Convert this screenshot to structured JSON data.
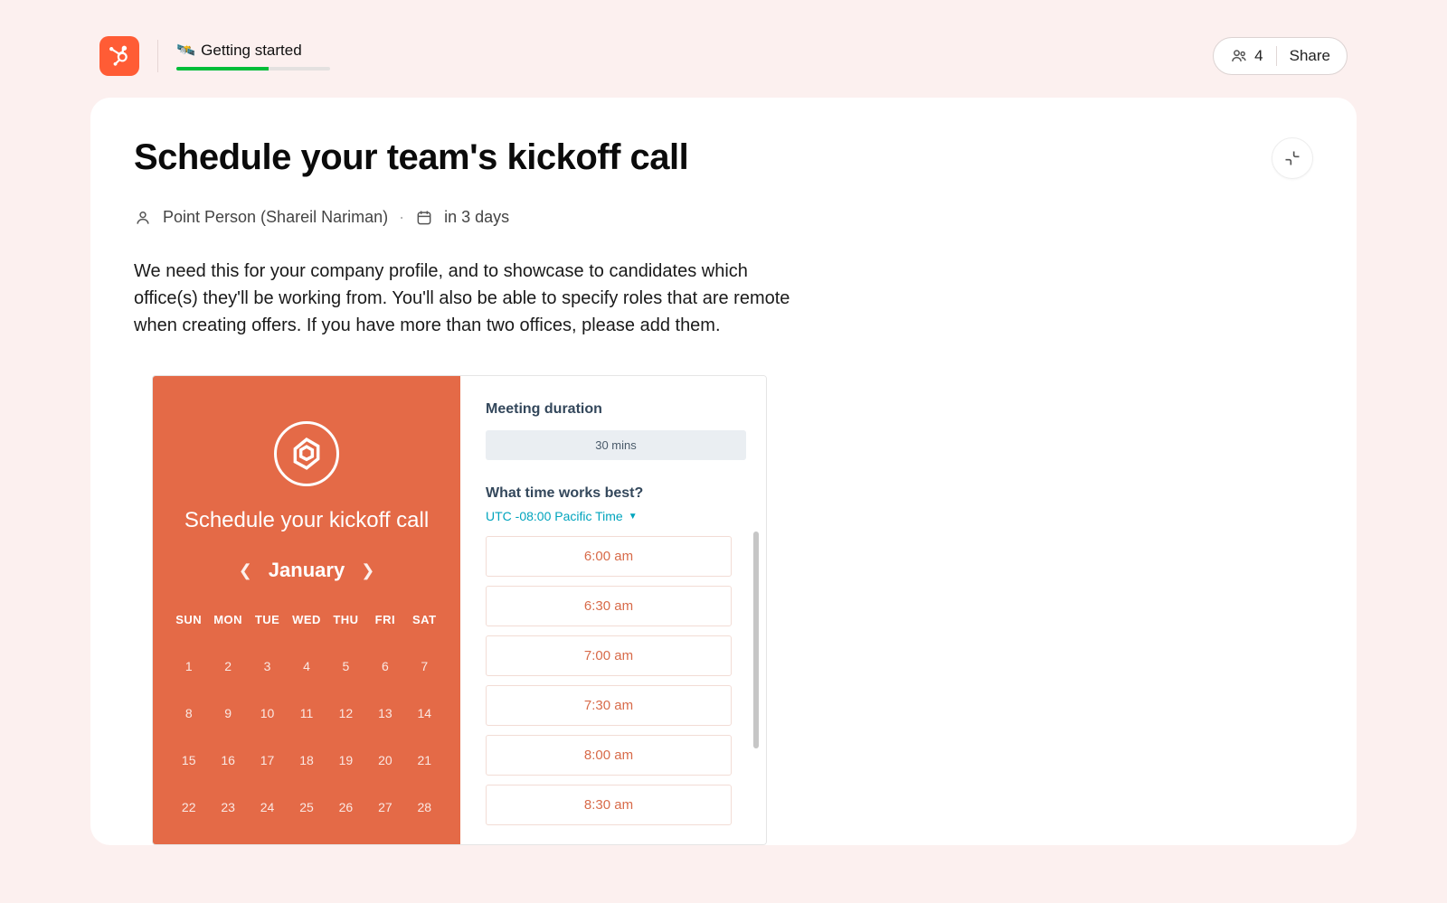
{
  "header": {
    "getting_started_emoji": "🛰️",
    "getting_started_label": "Getting started",
    "progress_pct": 60,
    "people_count": "4",
    "share_label": "Share"
  },
  "card": {
    "title": "Schedule your team's kickoff call",
    "point_person_label": "Point Person (Shareil Nariman)",
    "dot": "·",
    "due_label": "in 3 days",
    "body": "We need this for your company profile, and to showcase to candidates which office(s) they'll be working from. You'll also be able to specify roles that are remote when creating offers. If you have more than two offices, please add them."
  },
  "scheduler": {
    "left": {
      "title": "Schedule your kickoff call",
      "month": "January",
      "dow": [
        "SUN",
        "MON",
        "TUE",
        "WED",
        "THU",
        "FRI",
        "SAT"
      ],
      "rows": [
        [
          "1",
          "2",
          "3",
          "4",
          "5",
          "6",
          "7"
        ],
        [
          "8",
          "9",
          "10",
          "11",
          "12",
          "13",
          "14"
        ],
        [
          "15",
          "16",
          "17",
          "18",
          "19",
          "20",
          "21"
        ],
        [
          "22",
          "23",
          "24",
          "25",
          "26",
          "27",
          "28"
        ]
      ]
    },
    "right": {
      "duration_label": "Meeting duration",
      "duration_value": "30 mins",
      "time_label": "What time works best?",
      "timezone": "UTC -08:00 Pacific Time",
      "slots": [
        "6:00 am",
        "6:30 am",
        "7:00 am",
        "7:30 am",
        "8:00 am",
        "8:30 am"
      ]
    }
  }
}
